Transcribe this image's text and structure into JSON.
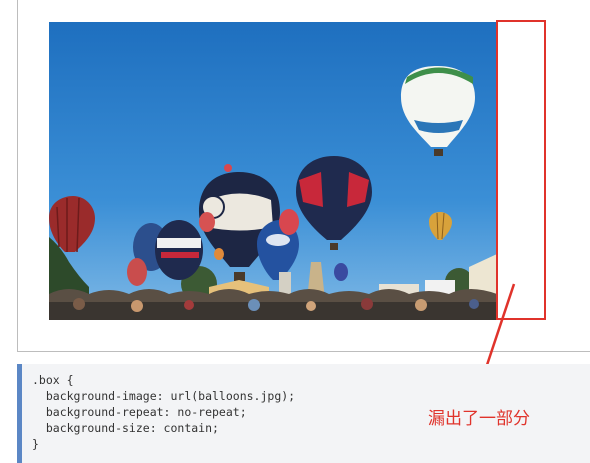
{
  "photo": {
    "alt": "hot air balloons over a festival crowd"
  },
  "code": {
    "lines": [
      ".box {",
      "  background-image: url(balloons.jpg);",
      "  background-repeat: no-repeat;",
      "  background-size: contain;",
      "}"
    ]
  },
  "annotation": {
    "text": "漏出了一部分"
  },
  "colors": {
    "highlight": "#e0332b",
    "code_border": "#5b87c5",
    "code_bg": "#f3f4f6",
    "sky": "#2f7fc8"
  }
}
